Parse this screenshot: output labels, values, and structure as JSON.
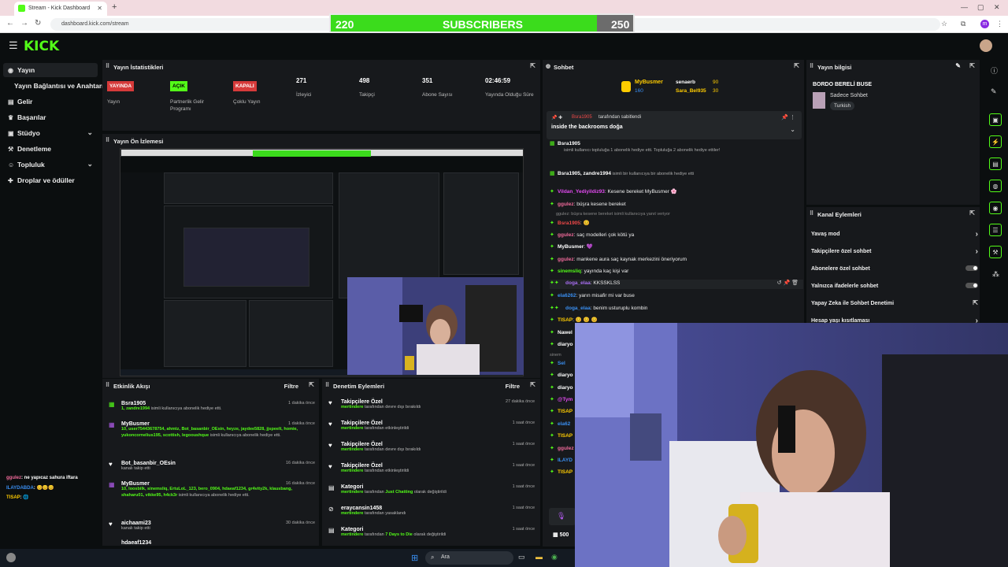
{
  "browser": {
    "tab_title": "Stream - Kick Dashboard",
    "url": "dashboard.kick.com/stream",
    "new_tab": "+",
    "close": "✕",
    "profile_initial": "m"
  },
  "sub_goal": {
    "current": "220",
    "label": "SUBSCRIBERS",
    "goal": "250",
    "progress": 0.88
  },
  "header": {
    "logo": "KICK"
  },
  "sidebar": {
    "items": [
      {
        "label": "Yayın",
        "icon": "broadcast-icon"
      },
      {
        "label": "Yayın Bağlantısı ve Anahtarı",
        "icon": ""
      },
      {
        "label": "Gelir",
        "icon": "wallet-icon"
      },
      {
        "label": "Başarılar",
        "icon": "trophy-icon"
      },
      {
        "label": "Stüdyo",
        "icon": "studio-icon"
      },
      {
        "label": "Denetleme",
        "icon": "gavel-icon"
      },
      {
        "label": "Topluluk",
        "icon": "users-icon"
      },
      {
        "label": "Droplar ve ödüller",
        "icon": "gift-icon"
      }
    ]
  },
  "stats": {
    "title": "Yayın İstatistikleri",
    "items": [
      {
        "value": "YAYINDA",
        "label": "Yayın",
        "kind": "red"
      },
      {
        "value": "AÇIK",
        "label": "Partnerlik Gelir Programı",
        "kind": "green"
      },
      {
        "value": "KAPALI",
        "label": "Çoklu Yayın",
        "kind": "red"
      },
      {
        "value": "271",
        "label": "İzleyici",
        "kind": "num"
      },
      {
        "value": "498",
        "label": "Takipçi",
        "kind": "num"
      },
      {
        "value": "351",
        "label": "Abone Sayısı",
        "kind": "num"
      },
      {
        "value": "02:46:59",
        "label": "Yayında Olduğu Süre",
        "kind": "num"
      }
    ]
  },
  "preview": {
    "title": "Yayın Ön İzlemesi"
  },
  "activity": {
    "title": "Etkinlik Akışı",
    "filter": "Filtre",
    "rows": [
      {
        "title": "Bsra1905",
        "sub_green": "1, zandre1994",
        "sub": " isimli kullanıcıya abonelik hediye etti.",
        "time": "1 dakika önce"
      },
      {
        "title": "MyBusmer",
        "sub_green": "10, user75443678754, ahmtz, Bot_basanbir_OEsin, heyze, jaydee5828, jjspeelt, homie, yukoncornelius195, scottish, legooushque",
        "sub": " isimli kullanıcıya abonelik hediye etti.",
        "time": "1 dakika önce"
      },
      {
        "title": "Bot_basanbir_OEsin",
        "sub_green": "",
        "sub": "kanalı takip etti",
        "time": "16 dakika önce"
      },
      {
        "title": "MyBusmer",
        "sub_green": "10, loosbilk, sinemsliq, ErtuLoL_123, bero_0904, hdaeaf1234, gr4vity2k, klausbang, shaharu01, vikke95, h4ck3r",
        "sub": " isimli kullanıcıya abonelik hediye etti.",
        "time": "16 dakika önce"
      },
      {
        "title": "aichaami23",
        "sub_green": "",
        "sub": "kanalı takip etti",
        "time": "30 dakika önce"
      },
      {
        "title": "hdaeaf1234",
        "sub_green": "",
        "sub": "",
        "time": ""
      }
    ]
  },
  "moderation": {
    "title": "Denetim Eylemleri",
    "filter": "Filtre",
    "rows": [
      {
        "title": "Takipçilere Özel",
        "actor": "mertindere",
        "action": " tarafından devre dışı bırakıldı",
        "extra": "",
        "time": "27 dakika önce"
      },
      {
        "title": "Takipçilere Özel",
        "actor": "mertindere",
        "action": " tarafından etkinleştirildi",
        "extra": "",
        "time": "1 saat önce"
      },
      {
        "title": "Takipçilere Özel",
        "actor": "mertindere",
        "action": " tarafından devre dışı bırakıldı",
        "extra": "",
        "time": "1 saat önce"
      },
      {
        "title": "Takipçilere Özel",
        "actor": "mertindere",
        "action": " tarafından etkinleştirildi",
        "extra": "",
        "time": "1 saat önce"
      },
      {
        "title": "Kategori",
        "actor": "mertindere",
        "action": " tarafından ",
        "extra": "Just Chatting",
        "tail": " olarak değiştirildi",
        "time": "1 saat önce"
      },
      {
        "title": "eraycansin1458",
        "actor": "mertindere",
        "action": " tarafından yasaklandı",
        "extra": "",
        "time": "1 saat önce"
      },
      {
        "title": "Kategori",
        "actor": "mertindere",
        "action": " tarafından ",
        "extra": "7 Days to Die",
        "tail": " olarak değiştirildi",
        "time": "1 saat önce"
      }
    ]
  },
  "chat": {
    "title": "Sohbet",
    "top_gifters": [
      {
        "name": "MyBusmer",
        "count": "160"
      },
      {
        "name": "senaerb",
        "count": "90"
      },
      {
        "name": "Sara_Bel935",
        "count": "30"
      }
    ],
    "pinned_by": "tarafından sabitlendi",
    "pinned_user": "Bsra1905",
    "pinned_text": "inside the backrooms doğa",
    "messages": [
      {
        "user": "Bsra1905",
        "text": "",
        "color": "#ffffff"
      },
      {
        "user": "",
        "text": "isimli kullanıcı topluluğa 1 abonelik hediye etti. Topluluğa 2 abonelik hediye ettiler!",
        "color": "#aaaaaa"
      },
      {
        "user": "Bsra1905, zandre1994",
        "text": " isimli bir kullanıcıya bir abonelik hediye etti",
        "color": "#ffffff"
      },
      {
        "user": "Vildan_Yediyildiz93",
        "text": ": Kesene bereket MyBusmer 🌸",
        "color": "#e24af0"
      },
      {
        "user": "ggulez",
        "text": ": büşra kesene bereket",
        "color": "#f06a9a"
      },
      {
        "user": "",
        "text": "ggulez: büşra kesene bereket isimli kullanıcıya yanıt veriyor",
        "color": "#888888"
      },
      {
        "user": "Bsra1905",
        "text": ": 😊",
        "color": "#f04848"
      },
      {
        "user": "ggulez",
        "text": ": saç modelleri çok kötü ya",
        "color": "#f06a9a"
      },
      {
        "user": "MyBusmer",
        "text": ": 💜",
        "color": "#ffffff"
      },
      {
        "user": "ggulez",
        "text": ": mankene aura saç kaynak merkezini öneriyorum",
        "color": "#f06a9a"
      },
      {
        "user": "sinemsliq",
        "text": ": yayında kaç kişi var",
        "color": "#53fc18"
      },
      {
        "user": "doga_elaa",
        "text": ": KKSSKLSS",
        "color": "#a86ef2"
      },
      {
        "user": "ela6262",
        "text": ": yarın misafir mi var buse",
        "color": "#3a8ef0"
      },
      {
        "user": "doga_elaa",
        "text": ": benim usturuplu kombin",
        "color": "#3a8ef0"
      },
      {
        "user": "TISAP",
        "text": ": 😊 😊 😊",
        "color": "#ffcc00"
      },
      {
        "user": "Nawel",
        "text": "",
        "color": "#ffffff"
      },
      {
        "user": "diaryo",
        "text": "",
        "color": "#ffffff"
      },
      {
        "user": "sinem",
        "text": "",
        "color": "#888888"
      },
      {
        "user": "Sel",
        "text": "",
        "color": "#3a8ef0"
      },
      {
        "user": "diaryo",
        "text": "",
        "color": "#ffffff"
      },
      {
        "user": "diaryo",
        "text": "",
        "color": "#ffffff"
      },
      {
        "user": "@Tym",
        "text": "",
        "color": "#e24af0"
      },
      {
        "user": "TISAP",
        "text": "",
        "color": "#ffcc00"
      },
      {
        "user": "ela62",
        "text": "",
        "color": "#3a8ef0"
      },
      {
        "user": "TISAP",
        "text": "",
        "color": "#ffcc00"
      },
      {
        "user": "ggulez",
        "text": "",
        "color": "#f06a9a"
      },
      {
        "user": "ILAYD",
        "text": "",
        "color": "#3a8ef0"
      },
      {
        "user": "TISAP",
        "text": "",
        "color": "#ffcc00"
      }
    ],
    "input_count": "500"
  },
  "stream_info": {
    "title": "Yayın bilgisi",
    "stream_title": "BORDO BERELİ BUSE",
    "category": "Sadece Sohbet",
    "tag": "Turkish"
  },
  "channel_actions": {
    "title": "Kanal Eylemleri",
    "rows": [
      {
        "label": "Yavaş mod",
        "control": "chevron"
      },
      {
        "label": "Takipçilere özel sohbet",
        "control": "chevron"
      },
      {
        "label": "Abonelere özel sohbet",
        "control": "toggle"
      },
      {
        "label": "Yalnızca ifadelerle sohbet",
        "control": "toggle"
      },
      {
        "label": "Yapay Zeka ile Sohbet Denetimi",
        "control": "external"
      },
      {
        "label": "Hesap yaşı kısıtlaması",
        "control": "chevron"
      }
    ]
  },
  "overlay_chat": [
    {
      "user": "ggulez",
      "text": ": ne yapıcaz sahura iftara"
    },
    {
      "user": "ILAYDABDA",
      "text": ": 😊😊😊"
    },
    {
      "user": "TISAP",
      "text": ": 🌐"
    }
  ],
  "taskbar": {
    "search": "Ara"
  },
  "colors": {
    "accent": "#53fc18",
    "panel": "#17191c",
    "bg": "#0b0e0f",
    "red_badge": "#d63a3a"
  }
}
